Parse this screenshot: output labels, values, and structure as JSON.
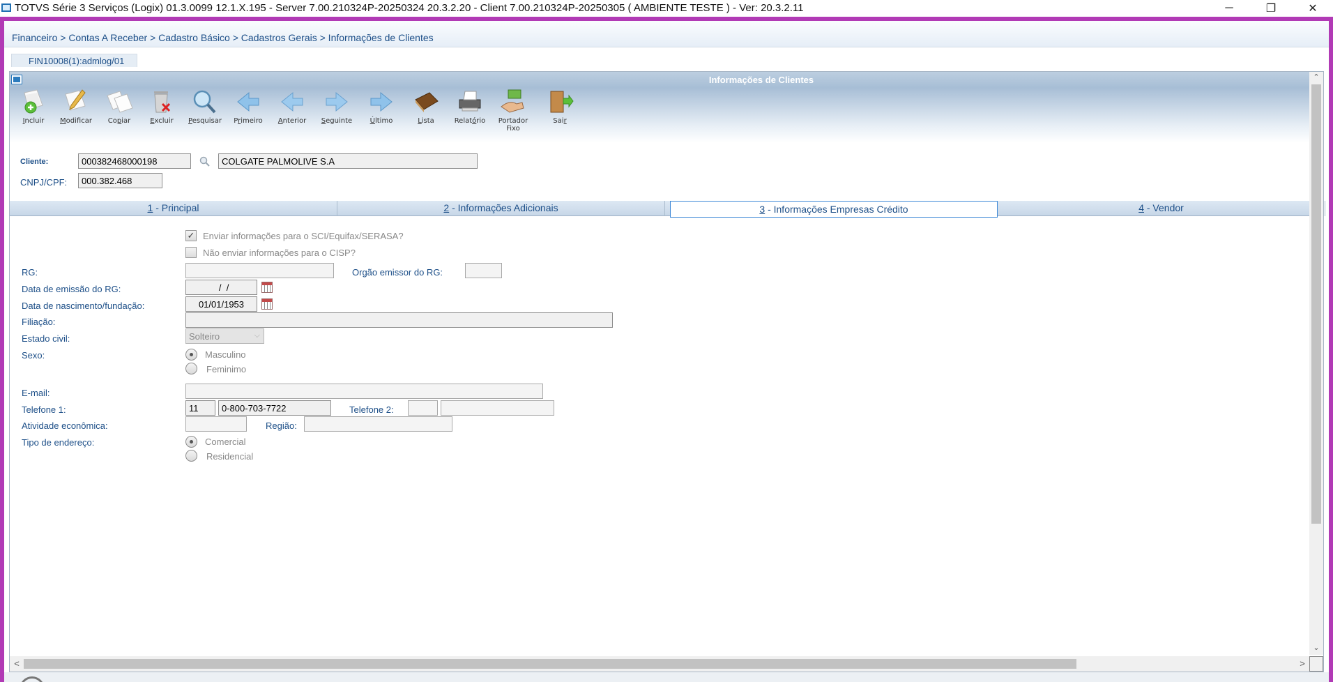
{
  "window": {
    "title": "TOTVS Série 3 Serviços (Logix) 01.3.0099   12.1.X.195 - Server 7.00.210324P-20250324 20.3.2.20 - Client 7.00.210324P-20250305    ( AMBIENTE TESTE )  - Ver: 20.3.2.11",
    "min_icon": "─",
    "restore_icon": "❐",
    "close_icon": "✕"
  },
  "breadcrumb": "Financeiro > Contas A Receber > Cadastro Básico > Cadastros Gerais > Informações de Clientes",
  "doc_tab": "FIN10008(1):admlog/01",
  "panel_title": "Informações de Clientes",
  "toolbar": [
    {
      "name": "incluir",
      "icon": "add-doc-icon",
      "pre": "",
      "u": "I",
      "post": "ncluir"
    },
    {
      "name": "modificar",
      "icon": "edit-doc-icon",
      "pre": "",
      "u": "M",
      "post": "odificar"
    },
    {
      "name": "copiar",
      "icon": "copy-doc-icon",
      "pre": "Co",
      "u": "p",
      "post": "iar"
    },
    {
      "name": "excluir",
      "icon": "trash-icon",
      "pre": "",
      "u": "E",
      "post": "xcluir"
    },
    {
      "name": "pesquisar",
      "icon": "magnifier-icon",
      "pre": "",
      "u": "P",
      "post": "esquisar"
    },
    {
      "name": "primeiro",
      "icon": "first-arrow-icon",
      "pre": "P",
      "u": "r",
      "post": "imeiro"
    },
    {
      "name": "anterior",
      "icon": "previous-arrow-icon",
      "pre": "",
      "u": "A",
      "post": "nterior"
    },
    {
      "name": "seguinte",
      "icon": "next-arrow-icon",
      "pre": "",
      "u": "S",
      "post": "eguinte"
    },
    {
      "name": "ultimo",
      "icon": "last-arrow-icon",
      "pre": "",
      "u": "Ú",
      "post": "ltimo"
    },
    {
      "name": "lista",
      "icon": "book-icon",
      "pre": "",
      "u": "L",
      "post": "ista"
    },
    {
      "name": "relatorio",
      "icon": "printer-icon",
      "pre": "Relat",
      "u": "ó",
      "post": "rio"
    },
    {
      "name": "portador-fixo",
      "icon": "hand-money-icon",
      "pre": "Portador\nFixo",
      "u": "",
      "post": ""
    },
    {
      "name": "sair",
      "icon": "exit-door-icon",
      "pre": "Sai",
      "u": "r",
      "post": ""
    }
  ],
  "form": {
    "cliente_label": "Cliente:",
    "cliente_code": "000382468000198",
    "cliente_name": "COLGATE PALMOLIVE S.A",
    "cnpj_label": "CNPJ/CPF:",
    "cnpj_value": "000.382.468"
  },
  "tabs": [
    {
      "num": "1",
      "label": " - Principal",
      "active": false
    },
    {
      "num": "2",
      "label": " - Informações Adicionais",
      "active": false
    },
    {
      "num": "3",
      "label": " - Informações Empresas Crédito",
      "active": true
    },
    {
      "num": "4",
      "label": " - Vendor",
      "active": false
    }
  ],
  "credit": {
    "chk_serasa": "Enviar informações para o SCI/Equifax/SERASA?",
    "chk_serasa_checked": true,
    "chk_serasa_mark": "✓",
    "chk_cisp": "Não enviar informações para o CISP?",
    "chk_cisp_checked": false,
    "rg_label": "RG:",
    "rg_value": "",
    "orgao_label": "Orgão emissor do RG:",
    "orgao_value": "",
    "emissao_label": "Data de emissão do RG:",
    "emissao_value": "  /  /",
    "nascimento_label": "Data de nascimento/fundação:",
    "nascimento_value": "01/01/1953",
    "filiacao_label": "Filiação:",
    "filiacao_value": "",
    "estado_civil_label": "Estado civil:",
    "estado_civil_value": "Solteiro",
    "estado_civil_arrow": "⌵",
    "sexo_label": "Sexo:",
    "sexo_options": [
      "Masculino",
      "Feminimo"
    ],
    "sexo_selected": "Masculino",
    "email_label": "E-mail:",
    "email_value": "",
    "tel1_label": "Telefone 1:",
    "tel1_ddd": "11",
    "tel1_number": "0-800-703-7722",
    "tel2_label": "Telefone 2:",
    "tel2_ddd": "",
    "tel2_number": "",
    "atividade_label": "Atividade econômica:",
    "atividade_value": "",
    "regiao_label": "Região:",
    "regiao_value": "",
    "tipo_end_label": "Tipo de endereço:",
    "tipo_end_options": [
      "Comercial",
      "Residencial"
    ],
    "tipo_end_selected": "Comercial"
  },
  "scroll": {
    "up": "⌃",
    "down": "⌄",
    "left": "<",
    "right": ">"
  }
}
